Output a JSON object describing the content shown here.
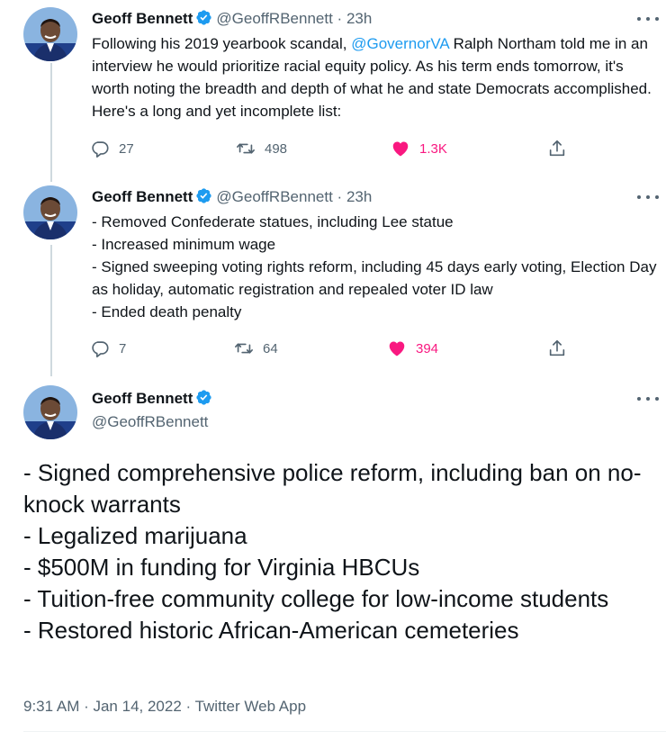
{
  "author": {
    "name": "Geoff Bennett",
    "handle": "@GeoffRBennett"
  },
  "tweets": [
    {
      "name": "Geoff Bennett",
      "handle": "@GeoffRBennett",
      "sep": "·",
      "time": "23h",
      "text_before_link": "Following his 2019 yearbook scandal, ",
      "link": "@GovernorVA",
      "text_after_link": " Ralph Northam told me in an interview he would prioritize racial equity policy. As his term ends tomorrow, it's worth noting the breadth and depth of what he and state Democrats accomplished. Here's a long and yet incomplete list:",
      "replies": "27",
      "retweets": "498",
      "likes": "1.3K"
    },
    {
      "name": "Geoff Bennett",
      "handle": "@GeoffRBennett",
      "sep": "·",
      "time": "23h",
      "text": "- Removed Confederate statues, including Lee statue\n- Increased minimum wage\n- Signed sweeping voting rights reform, including 45 days early voting, Election Day as holiday, automatic registration and repealed voter ID law\n- Ended death penalty",
      "replies": "7",
      "retweets": "64",
      "likes": "394"
    }
  ],
  "main_tweet": {
    "name": "Geoff Bennett",
    "handle": "@GeoffRBennett",
    "text": "- Signed comprehensive police reform, including ban on no-knock warrants\n- Legalized marijuana\n- $500M in funding for Virginia HBCUs\n- Tuition-free community college for low-income students\n- Restored historic African-American cemeteries",
    "timestamp": "9:31 AM · Jan 14, 2022 · Twitter Web App"
  },
  "icons": {
    "reply": "reply-icon",
    "retweet": "retweet-icon",
    "like": "heart-icon",
    "share": "share-icon",
    "verified": "verified-badge-icon",
    "more": "more-icon"
  },
  "colors": {
    "link": "#1d9bf0",
    "like": "#f91880",
    "muted": "#536471",
    "text": "#0f1419",
    "thread_line": "#cfd9de"
  }
}
